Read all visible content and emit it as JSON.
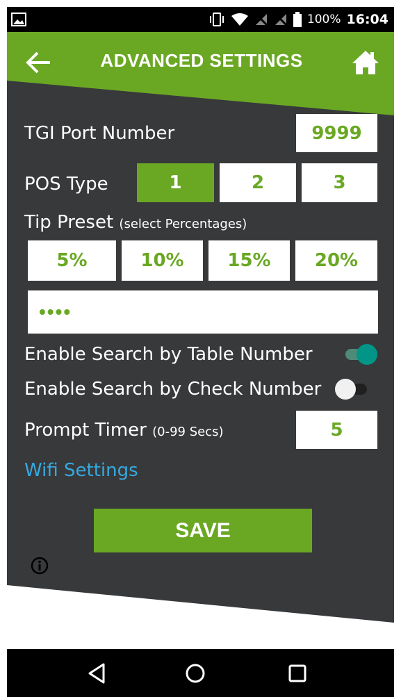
{
  "status_bar": {
    "battery_percent": "100%",
    "time": "16:04",
    "icons": [
      "gallery-notification-icon",
      "vibrate-icon",
      "wifi-icon",
      "no-sim-icon",
      "no-sim-icon",
      "battery-icon"
    ]
  },
  "header": {
    "title": "ADVANCED SETTINGS",
    "back_icon": "arrow-left-icon",
    "home_icon": "home-icon"
  },
  "settings": {
    "tgi_port": {
      "label": "TGI Port Number",
      "value": "9999"
    },
    "pos_type": {
      "label": "POS Type",
      "options": [
        "1",
        "2",
        "3"
      ],
      "selected": "1"
    },
    "tip_preset": {
      "label": "Tip Preset",
      "hint": "(select Percentages)",
      "options": [
        "5%",
        "10%",
        "15%",
        "20%"
      ],
      "custom_value_masked": "••••"
    },
    "search_table": {
      "label": "Enable Search by Table Number",
      "enabled": true
    },
    "search_check": {
      "label": "Enable Search by Check Number",
      "enabled": false
    },
    "prompt_timer": {
      "label": "Prompt Timer",
      "hint": "(0-99 Secs)",
      "value": "5"
    },
    "wifi_link": "Wifi Settings"
  },
  "save_label": "SAVE",
  "colors": {
    "accent_green": "#6aa824",
    "dark_panel": "#38393b",
    "link_blue": "#36a9e0",
    "toggle_on": "#009587"
  },
  "nav_bar": {
    "icons": [
      "back-triangle-icon",
      "home-circle-icon",
      "recents-square-icon"
    ]
  }
}
